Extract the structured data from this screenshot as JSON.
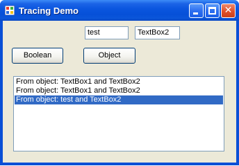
{
  "window": {
    "title": "Tracing Demo",
    "title_color": "#ffffff",
    "frame_color": "#0a4fd6"
  },
  "titlebar_buttons": {
    "minimize_icon": "minimize-icon",
    "maximize_icon": "maximize-icon",
    "close_icon": "close-icon",
    "close_glyph": "✕"
  },
  "inputs": {
    "first": {
      "value": "test"
    },
    "second": {
      "value": "TextBox2"
    }
  },
  "buttons": {
    "boolean_label": "Boolean",
    "object_label": "Object"
  },
  "listbox": {
    "items": [
      {
        "text": "From object: TextBox1 and TextBox2",
        "selected": false
      },
      {
        "text": "From object: TextBox1 and TextBox2",
        "selected": false
      },
      {
        "text": "From object: test and TextBox2",
        "selected": true
      }
    ],
    "selection_color": "#316ac5"
  }
}
